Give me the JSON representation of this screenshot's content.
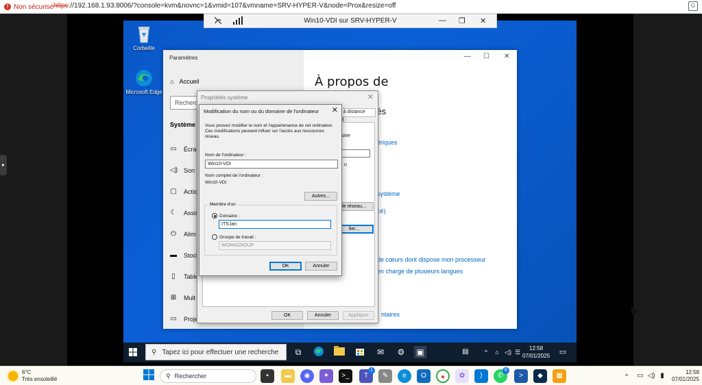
{
  "browser": {
    "security_label": "Non sécurisé",
    "url_protocol": "https",
    "url_rest": "://192.168.1.93:8006/?console=kvm&novnc=1&vmid=107&vmname=SRV-HYPER-V&node=Prox&resize=off"
  },
  "vnc": {
    "title": "Win10-VDI sur SRV-HYPER-V"
  },
  "desktop": {
    "icons": [
      {
        "label": "Corbeille"
      },
      {
        "label": "Microsoft Edge"
      }
    ]
  },
  "settings": {
    "title": "Paramètres",
    "home": "Accueil",
    "search_placeholder": "Recherche",
    "section": "Système",
    "nav": [
      "Écran",
      "Son",
      "Actio",
      "Assis",
      "Alim",
      "Stock",
      "Table",
      "Mult",
      "Proje"
    ],
    "heading": "À propos de",
    "spec_heading": "ciés",
    "texts": {
      "rename_hint": "r votre",
      "u": "u"
    },
    "links": {
      "link1": "ériques",
      "link2": "système",
      "link3": "cé)",
      "link4": "de cœurs dont dispose mon processeur",
      "link5": "en charge de plusieurs langues",
      "link6": "ntaires"
    }
  },
  "props": {
    "title": "Propriétés système",
    "tab_remote": "on à distance",
    "tab_el": "el",
    "network_btn": "le réseau...",
    "modify_btn": "fier...",
    "ok": "OK",
    "cancel": "Annuler",
    "apply": "Appliquer"
  },
  "modif": {
    "title": "Modification du nom ou du domaine de l'ordinateur",
    "description": "Vous pouvez modifier le nom et l'appartenance de cet ordinateur. Ces modifications peuvent influer sur l'accès aux ressources réseau.",
    "computer_name_label": "Nom de l'ordinateur :",
    "computer_name_value": "Win10-VDI",
    "full_name_label": "Nom complet de l'ordinateur :",
    "full_name_value": "Win10-VDI",
    "others_btn": "Autres...",
    "member_of": "Membre d'un",
    "domain_label": "Domaine :",
    "domain_value": "ITS.lan",
    "workgroup_label": "Groupe de travail :",
    "workgroup_value": "WORKGROUP",
    "ok": "OK",
    "cancel": "Annuler"
  },
  "vm_taskbar": {
    "search_placeholder": "Tapez ici pour effectuer une recherche",
    "time": "12:58",
    "date": "07/01/2025"
  },
  "host_taskbar": {
    "temperature": "6°C",
    "weather": "Très ensoleillé",
    "search_placeholder": "Rechercher",
    "badge_teams": "1",
    "badge_whatsapp": "6",
    "time": "12:58",
    "date": "07/01/2025"
  },
  "colors": {
    "accent": "#0078d7",
    "link": "#0067c0",
    "desktop": "#0b5fd6"
  }
}
